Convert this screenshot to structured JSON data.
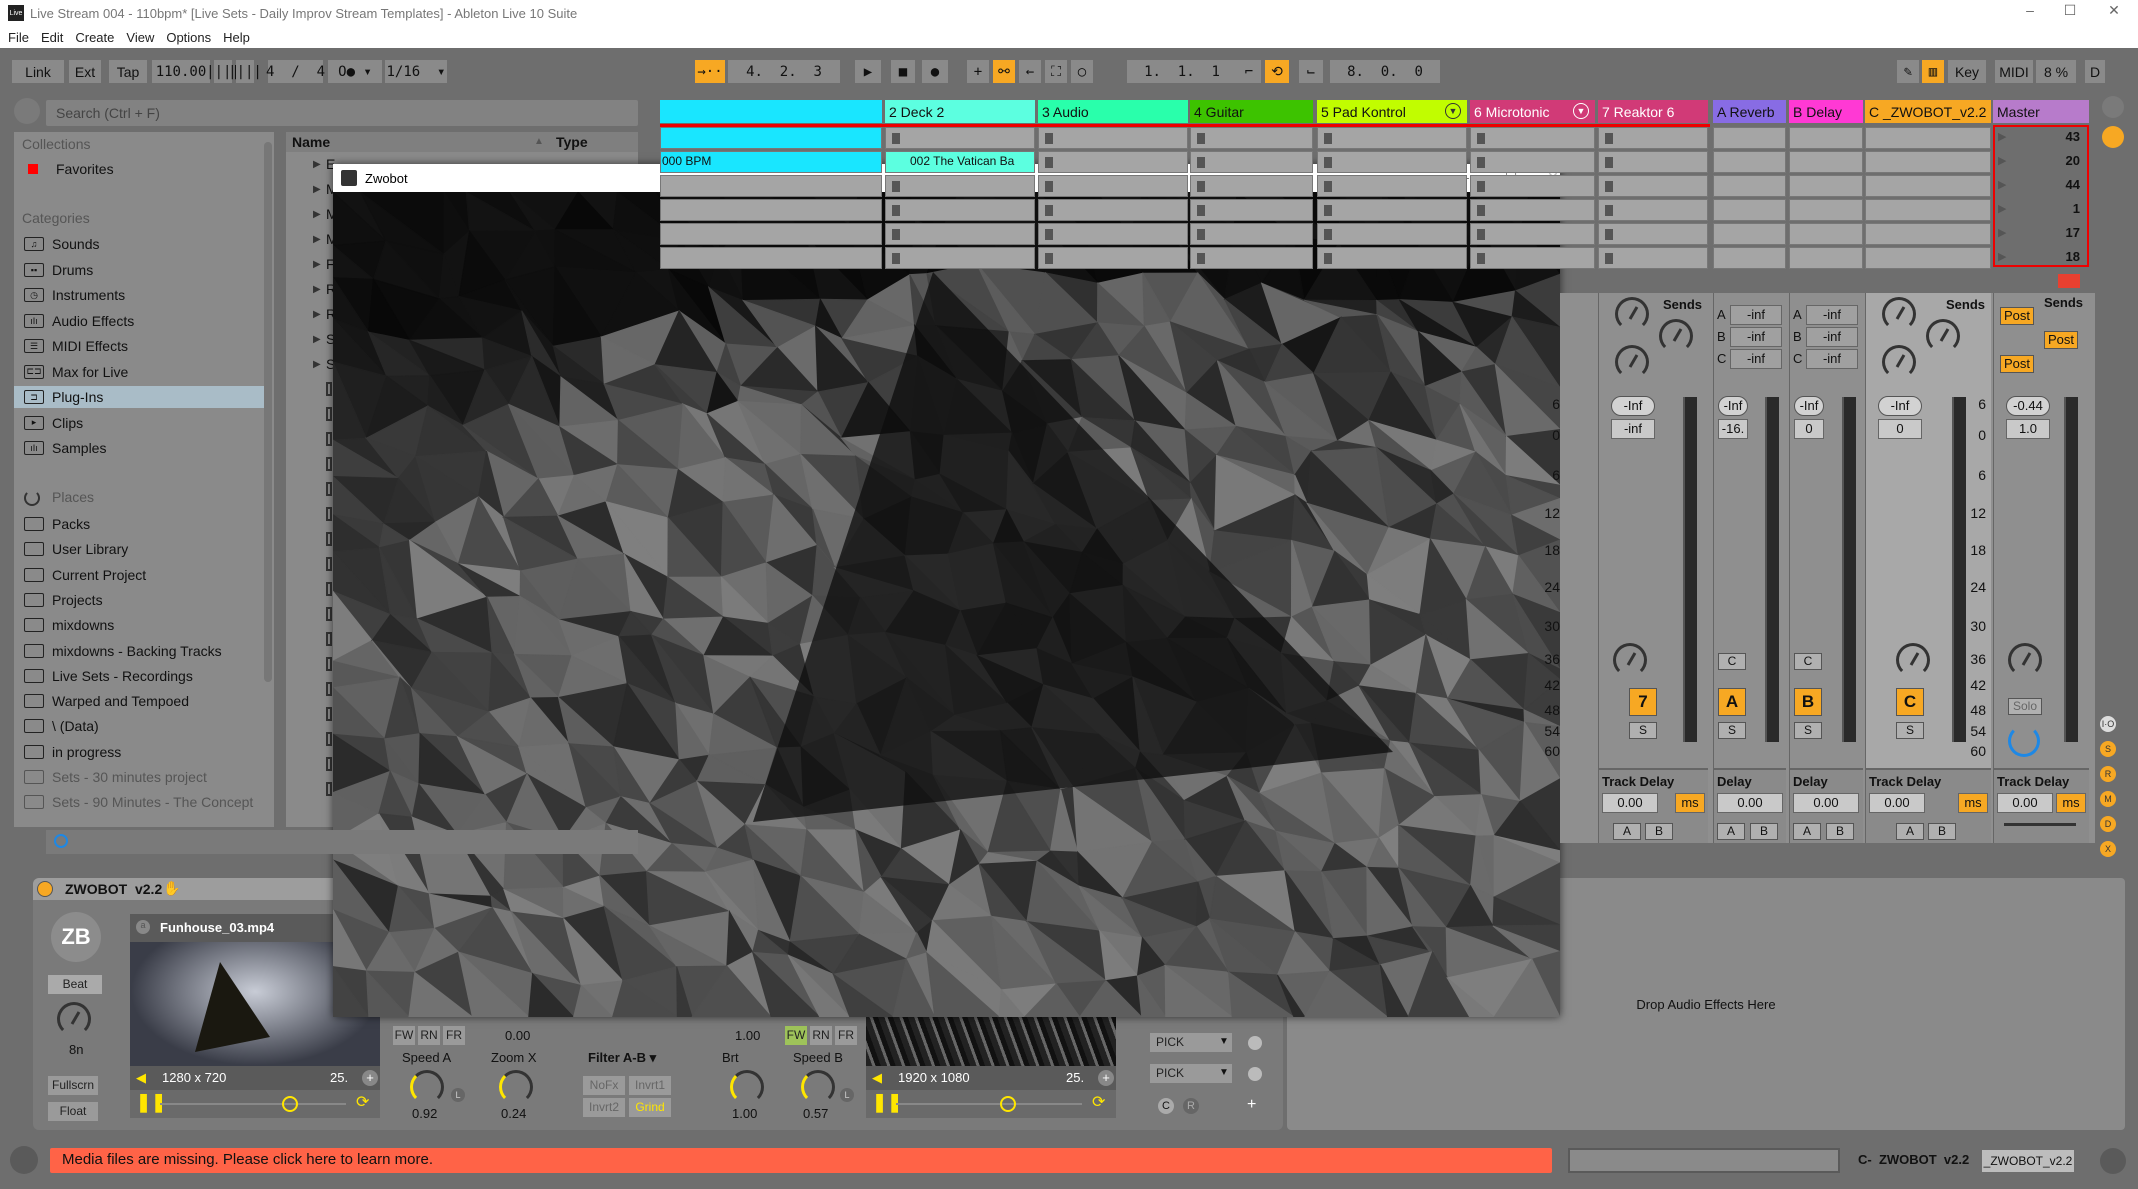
{
  "window": {
    "title": "Live Stream 004 - 110bpm*  [Live Sets - Daily Improv Stream Templates] - Ableton Live 10 Suite",
    "logo": "Live",
    "minimize": "–",
    "maximize": "☐",
    "close": "✕"
  },
  "menu": [
    "File",
    "Edit",
    "Create",
    "View",
    "Options",
    "Help"
  ],
  "toolbar": {
    "link": "Link",
    "ext": "Ext",
    "tap": "Tap",
    "tempo": "110.00",
    "nudge_down": "||||",
    "nudge_up": "||||",
    "signature": "4  /  4",
    "metro": "O● ▾",
    "quantize": "1/16  ▾",
    "follow": "→··",
    "position": "4.  2.  3",
    "play": "▶",
    "stop": "■",
    "record": "●",
    "overdub": "+",
    "automation": "⚯",
    "back": "←",
    "capture": "⛶",
    "loop_start_icon": "○",
    "loop_start": "1.  1.  1",
    "punch_in": "⌐",
    "loop_switch": "⟲",
    "punch_out": "⌙",
    "loop_length": "8.  0.  0",
    "draw": "✎",
    "key_map_icon": "▥",
    "key": "Key",
    "midi": "MIDI",
    "cpu": "8 %",
    "disk": "D"
  },
  "browser": {
    "search_placeholder": "Search (Ctrl + F)",
    "collections_label": "Collections",
    "favorites": "Favorites",
    "categories_label": "Categories",
    "categories": [
      {
        "label": "Sounds",
        "icon": "♫"
      },
      {
        "label": "Drums",
        "icon": "▪▪"
      },
      {
        "label": "Instruments",
        "icon": "◷"
      },
      {
        "label": "Audio Effects",
        "icon": "ıIı"
      },
      {
        "label": "MIDI Effects",
        "icon": "☰"
      },
      {
        "label": "Max for Live",
        "icon": "⊏⊐"
      },
      {
        "label": "Plug-Ins",
        "icon": "⊐"
      },
      {
        "label": "Clips",
        "icon": "▸"
      },
      {
        "label": "Samples",
        "icon": "ıIı"
      }
    ],
    "selected_category": "Plug-Ins",
    "places_label": "Places",
    "places": [
      "Packs",
      "User Library",
      "Current Project",
      "Projects",
      "mixdowns",
      "mixdowns - Backing Tracks",
      "Live Sets - Recordings",
      "Warped and Tempoed",
      "\\ (Data)",
      "in progress",
      "Sets - 30 minutes project",
      "Sets - 90 Minutes - The Concept"
    ],
    "columns": {
      "name": "Name",
      "type": "Type"
    },
    "rows": [
      "E",
      "M",
      "M",
      "M",
      "F",
      "R",
      "R",
      "S",
      "S"
    ]
  },
  "tracks": [
    {
      "name": "",
      "color": "#19e6ff"
    },
    {
      "name": "2 Deck 2",
      "color": "#5cffe0"
    },
    {
      "name": "3 Audio",
      "color": "#29ffab"
    },
    {
      "name": "4 Guitar",
      "color": "#3dc300"
    },
    {
      "name": "5 Pad Kontrol",
      "color": "#c1fd00"
    },
    {
      "name": "6 Microtonic",
      "color": "#d13a77",
      "light": true
    },
    {
      "name": "7 Reaktor 6",
      "color": "#d13a77",
      "light": true
    },
    {
      "name": "A Reverb",
      "color": "#886ce4"
    },
    {
      "name": "B Delay",
      "color": "#ff39d4"
    },
    {
      "name": "C _ZWOBOT_v2.2",
      "color": "#f7a823"
    },
    {
      "name": "Master",
      "color": "#b77bcb"
    }
  ],
  "clips": {
    "track1_row2": "000 BPM",
    "deck2_row2": "002 The Vatican Ba"
  },
  "scenes": [
    "43",
    "20",
    "44",
    "1",
    "17",
    "18"
  ],
  "mixer": {
    "sends_label": "Sends",
    "send_letters": [
      "A",
      "B",
      "C"
    ],
    "inf": "-inf",
    "post": "Post",
    "scale": [
      "6",
      "0",
      "6",
      "12",
      "18",
      "24",
      "30",
      "36",
      "42",
      "48",
      "54",
      "60"
    ],
    "strips": [
      {
        "id": "reaktor",
        "peak": "-Inf",
        "volume": "-inf",
        "button": "7"
      },
      {
        "id": "a-reverb",
        "peak": "-Inf",
        "volume": "-16.",
        "button": "A"
      },
      {
        "id": "b-delay",
        "peak": "-Inf",
        "volume": "0",
        "button": "B"
      },
      {
        "id": "c-zwobot",
        "peak": "-Inf",
        "volume": "0",
        "button": "C"
      },
      {
        "id": "master",
        "peak": "-0.44",
        "volume": "1.0",
        "button": "Solo"
      }
    ],
    "solo": "S",
    "cue": "C",
    "track_delay": "Track Delay",
    "delay": "Delay",
    "delay_value": "0.00",
    "ms": "ms",
    "xfade_a": "A",
    "xfade_b": "B",
    "side_buttons": [
      "I·O",
      "S",
      "R",
      "M",
      "D",
      "X"
    ]
  },
  "zwobot_window": {
    "title": "Zwobot",
    "minimize": "–",
    "maximize": "☐",
    "close": "✕"
  },
  "device": {
    "title": "ZWOBOT  v2.2",
    "logo": "ZB",
    "beat": "Beat",
    "beat_value": "8n",
    "fullscreen": "Fullscrn",
    "float": "Float",
    "deck_a": {
      "file": "Funhouse_03.mp4",
      "file_icon": "a",
      "resolution": "1280 x 720",
      "fps": "25.",
      "position": 0.7
    },
    "fw": "FW",
    "rn": "RN",
    "fr": "FR",
    "speed_a": {
      "label": "Speed A",
      "value": "0.92"
    },
    "zoom_x": {
      "label": "Zoom X",
      "value": "0.24",
      "above": "0.00"
    },
    "filter": {
      "label": "Filter A-B ▾",
      "buttons": [
        "NoFx",
        "Invrt1",
        "Invrt2",
        "Grind"
      ],
      "active": "Grind"
    },
    "brt": {
      "label": "Brt",
      "value": "1.00",
      "above": "1.00"
    },
    "speed_b": {
      "label": "Speed B",
      "value": "0.57"
    },
    "deck_b": {
      "resolution": "1920 x 1080",
      "fps": "25.",
      "position": 0.6
    },
    "pick": "PICK",
    "c": "C",
    "r": "R",
    "plus": "+",
    "lock": "L"
  },
  "drop_zone": "Drop Audio Effects Here",
  "status": {
    "message": "Media files are missing. Please click here to learn more.",
    "track": "C-  ZWOBOT  v2.2",
    "device": "_ZWOBOT_v2.2"
  },
  "colors": {
    "accent": "#f7a823",
    "status": "#ff6347",
    "knob": "#ffe600"
  }
}
